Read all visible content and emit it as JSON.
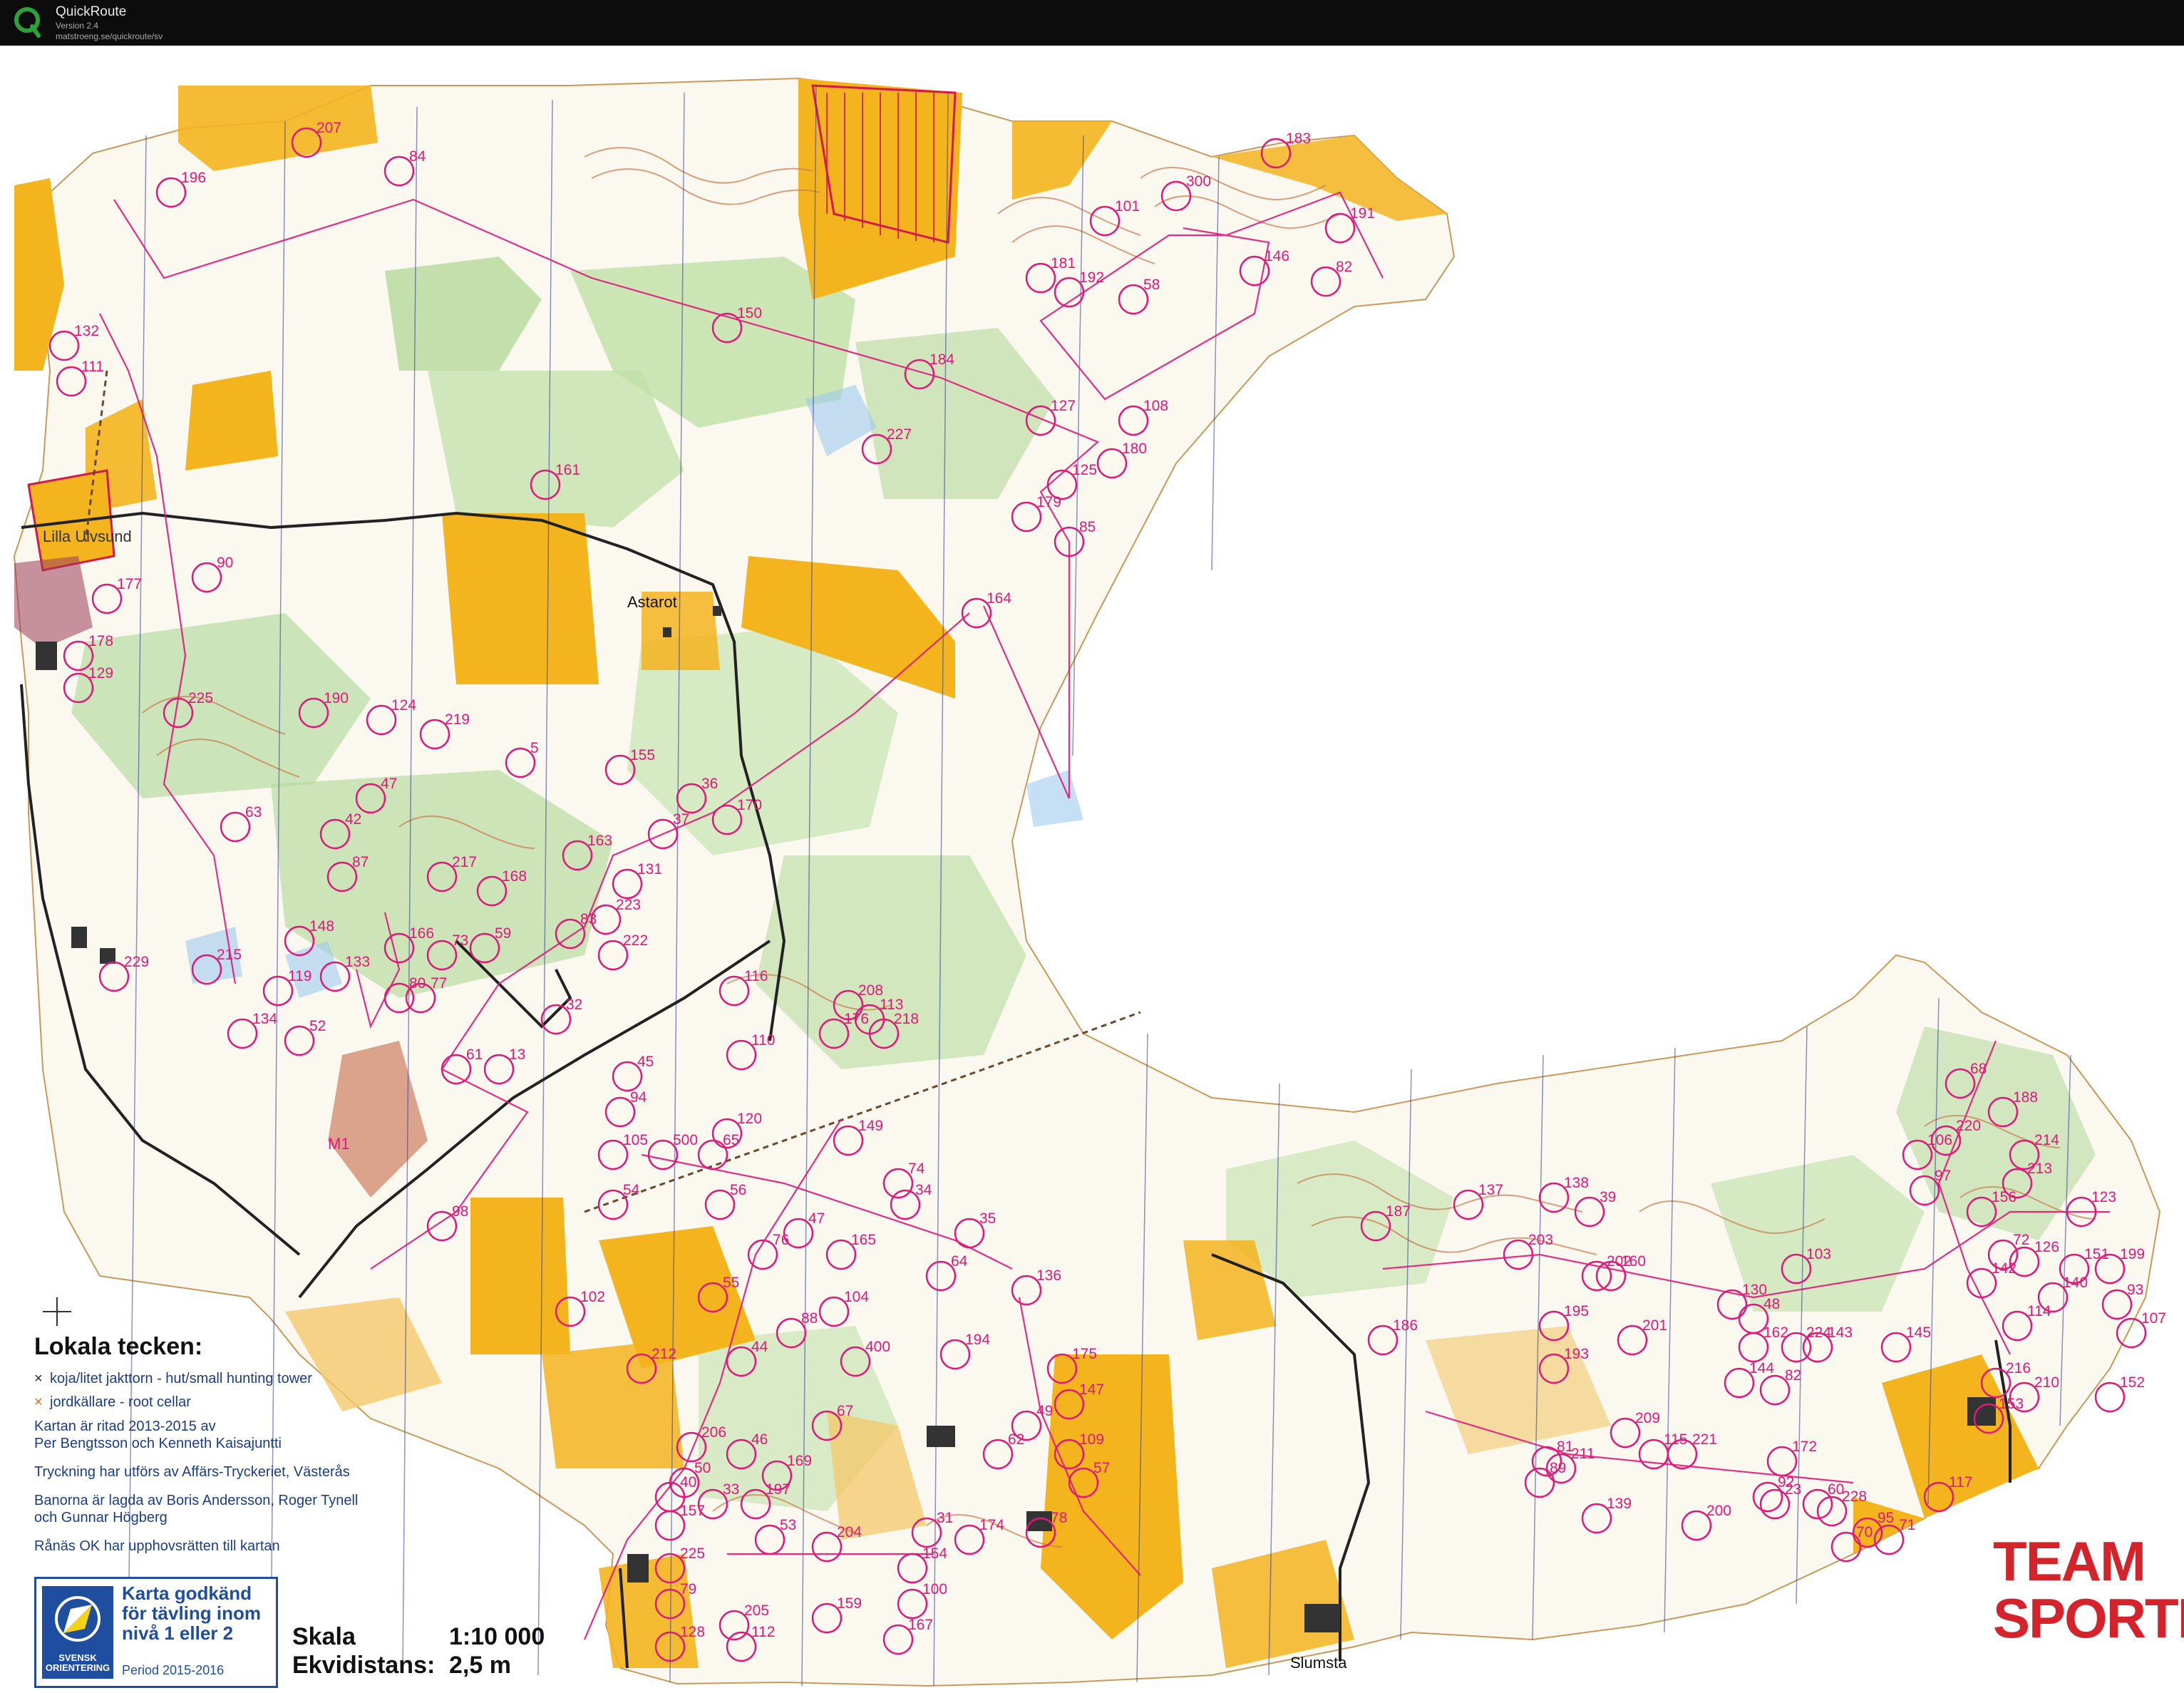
{
  "app": {
    "name": "QuickRoute",
    "version": "Version 2.4",
    "url": "matstroeng.se/quickroute/sv"
  },
  "map": {
    "place_names": [
      "Lilla Ulvsund",
      "Astarot",
      "Slumsta"
    ],
    "colors": {
      "open_land": "#f4b41e",
      "forest_green": "#b9dca0",
      "contour": "#c8794a",
      "course": "#e0187a",
      "water": "#9ec9ef",
      "road": "#222222",
      "out_of_bounds": "#d6184a"
    },
    "controls": [
      "207",
      "196",
      "84",
      "183",
      "101",
      "300",
      "191",
      "132",
      "111",
      "150",
      "181",
      "192",
      "58",
      "146",
      "82",
      "184",
      "127",
      "108",
      "161",
      "227",
      "180",
      "125",
      "179",
      "85",
      "90",
      "177",
      "164",
      "178",
      "129",
      "225",
      "190",
      "124",
      "219",
      "5",
      "155",
      "36",
      "170",
      "47",
      "63",
      "42",
      "37",
      "163",
      "131",
      "87",
      "217",
      "168",
      "229",
      "148",
      "166",
      "73",
      "59",
      "83",
      "223",
      "222",
      "215",
      "119",
      "133",
      "80",
      "77",
      "32",
      "116",
      "208",
      "113",
      "218",
      "134",
      "52",
      "61",
      "13",
      "45",
      "110",
      "176",
      "94",
      "105",
      "500",
      "65",
      "120",
      "149",
      "74",
      "34",
      "54",
      "56",
      "47",
      "76",
      "165",
      "35",
      "64",
      "98",
      "55",
      "88",
      "104",
      "136",
      "102",
      "212",
      "44",
      "400",
      "194",
      "175",
      "147",
      "206",
      "67",
      "49",
      "50",
      "46",
      "169",
      "109",
      "40",
      "33",
      "57",
      "197",
      "62",
      "157",
      "53",
      "204",
      "174",
      "78",
      "31",
      "154",
      "225",
      "79",
      "205",
      "159",
      "128",
      "112",
      "167",
      "100",
      "137",
      "138",
      "39",
      "187",
      "203",
      "202",
      "195",
      "160",
      "130",
      "48",
      "186",
      "201",
      "193",
      "224",
      "144",
      "209",
      "82",
      "162",
      "143",
      "81",
      "211",
      "115",
      "221",
      "172",
      "92",
      "139",
      "89",
      "200",
      "23",
      "228",
      "95",
      "60",
      "71",
      "70",
      "106",
      "68",
      "188",
      "220",
      "214",
      "213",
      "97",
      "156",
      "123",
      "72",
      "126",
      "103",
      "142",
      "140",
      "199",
      "151",
      "93",
      "107",
      "145",
      "114",
      "216",
      "210",
      "117",
      "152",
      "153",
      "121",
      "171",
      "118",
      "141"
    ]
  },
  "legend": {
    "title": "Lokala tecken:",
    "items": [
      {
        "symbol": "×",
        "text": "koja/litet jakttorn - hut/small hunting tower"
      },
      {
        "symbol": "×",
        "text": "jordkällare   -   root cellar"
      }
    ],
    "notes": [
      "Kartan är ritad 2013-2015 av\nPer Bengtsson och Kenneth Kaisajuntti",
      "Tryckning har utförs av Affärs-Tryckeriet, Västerås",
      "Banorna är lagda av Boris Andersson, Roger Tynell\noch Gunnar Högberg",
      "Rånäs OK har upphovsrätten till kartan"
    ]
  },
  "approval": {
    "org": "SVENSK ORIENTERING",
    "text": "Karta godkänd för tävling inom nivå 1 eller 2",
    "period": "Period 2015-2016"
  },
  "scale": {
    "scale_label": "Skala",
    "scale_value": "1:10 000",
    "contour_label": "Ekvidistans:",
    "contour_value": "2,5 m"
  },
  "brand": {
    "line1": "TEAM",
    "line2": "SPORTIA"
  },
  "mark_names": [
    "M1"
  ]
}
